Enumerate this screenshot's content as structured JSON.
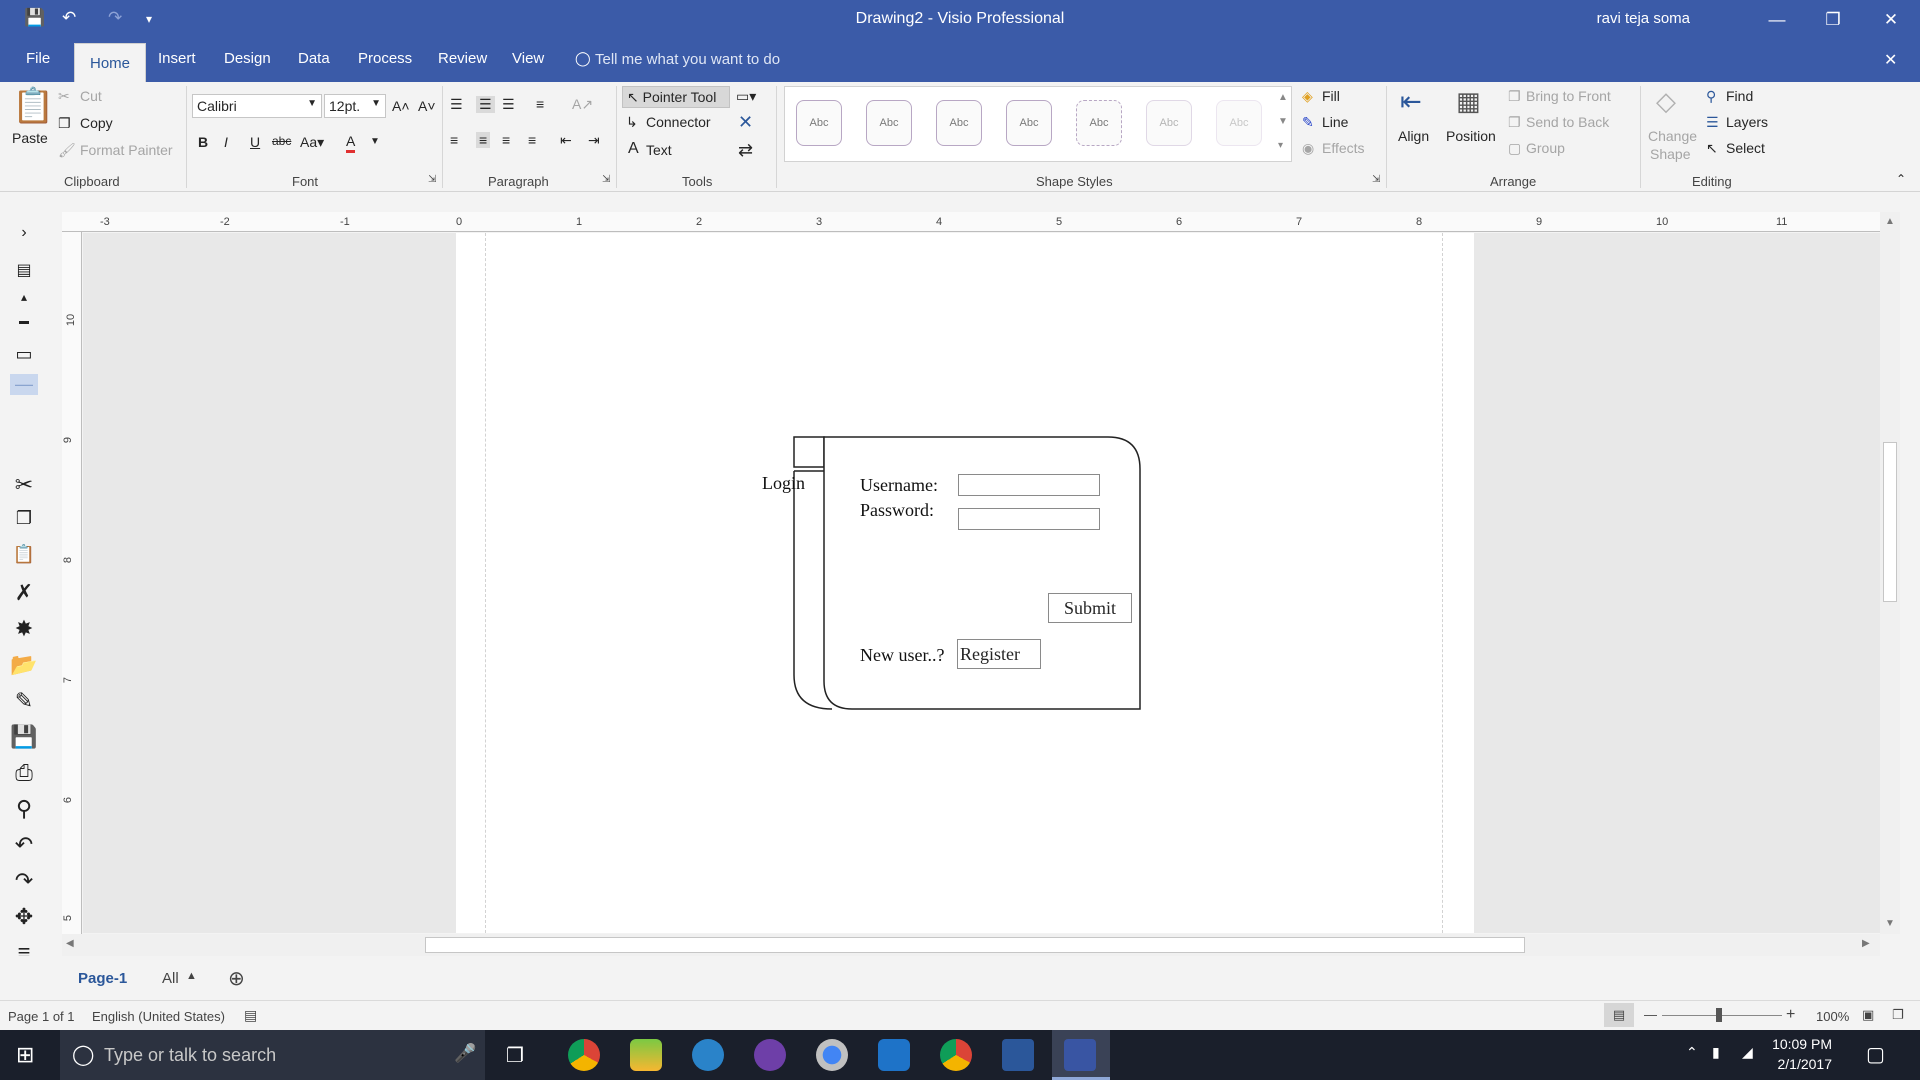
{
  "window": {
    "title": "Drawing2 - Visio Professional",
    "user": "ravi teja soma"
  },
  "tabs": [
    "File",
    "Home",
    "Insert",
    "Design",
    "Data",
    "Process",
    "Review",
    "View"
  ],
  "tell_me": "Tell me what you want to do",
  "ribbon": {
    "clipboard": {
      "paste": "Paste",
      "cut": "Cut",
      "copy": "Copy",
      "format_painter": "Format Painter",
      "label": "Clipboard"
    },
    "font": {
      "name": "Calibri",
      "size": "12pt.",
      "label": "Font"
    },
    "paragraph": {
      "label": "Paragraph"
    },
    "tools": {
      "pointer": "Pointer Tool",
      "connector": "Connector",
      "text": "Text",
      "label": "Tools"
    },
    "shape_styles": {
      "swatch": "Abc",
      "label": "Shape Styles",
      "fill": "Fill",
      "line": "Line",
      "effects": "Effects"
    },
    "arrange": {
      "align": "Align",
      "position": "Position",
      "bring_front": "Bring to Front",
      "send_back": "Send to Back",
      "group": "Group",
      "label": "Arrange"
    },
    "editing": {
      "change_shape_1": "Change",
      "change_shape_2": "Shape",
      "find": "Find",
      "layers": "Layers",
      "select": "Select",
      "label": "Editing"
    }
  },
  "ruler": {
    "h": [
      "-3",
      "-2",
      "-1",
      "0",
      "1",
      "2",
      "3",
      "4",
      "5",
      "6",
      "7",
      "8",
      "9",
      "10",
      "11"
    ],
    "v": [
      "10",
      "9",
      "8",
      "7",
      "6",
      "5"
    ]
  },
  "wireframe": {
    "title": "Login",
    "username_label": "Username:",
    "password_label": "Password:",
    "submit": "Submit",
    "new_user": "New user..?",
    "register": "Register"
  },
  "page_tabs": {
    "page": "Page-1",
    "all": "All"
  },
  "status": {
    "page_info": "Page 1 of 1",
    "language": "English (United States)",
    "zoom": "100%"
  },
  "taskbar": {
    "search_placeholder": "Type or talk to search",
    "time": "10:09 PM",
    "date": "2/1/2017"
  },
  "colors": {
    "accent": "#3b5ba8",
    "taskbar": "#1a1f2b"
  }
}
